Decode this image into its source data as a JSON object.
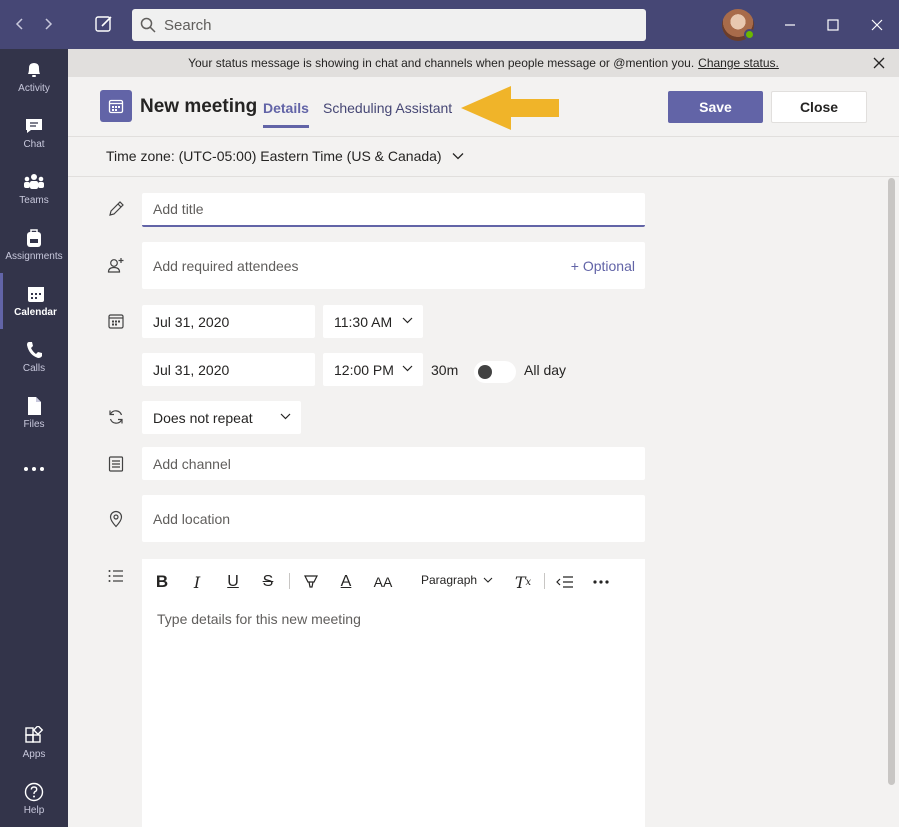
{
  "search": {
    "placeholder": "Search"
  },
  "rail": {
    "items": [
      {
        "label": "Activity"
      },
      {
        "label": "Chat"
      },
      {
        "label": "Teams"
      },
      {
        "label": "Assignments"
      },
      {
        "label": "Calendar"
      },
      {
        "label": "Calls"
      },
      {
        "label": "Files"
      },
      {
        "label": "Apps"
      },
      {
        "label": "Help"
      }
    ]
  },
  "banner": {
    "text": "Your status message is showing in chat and channels when people message or @mention you.",
    "link": "Change status."
  },
  "header": {
    "title": "New meeting",
    "tabs": [
      "Details",
      "Scheduling Assistant"
    ],
    "save_label": "Save",
    "close_label": "Close"
  },
  "timezone": "Time zone: (UTC-05:00) Eastern Time (US & Canada)",
  "form": {
    "title_placeholder": "Add title",
    "attendees_placeholder": "Add required attendees",
    "optional_label": "+ Optional",
    "start_date": "Jul 31, 2020",
    "start_time": "11:30 AM",
    "end_date": "Jul 31, 2020",
    "end_time": "12:00 PM",
    "duration": "30m",
    "all_day_label": "All day",
    "all_day_on": false,
    "repeat": "Does not repeat",
    "channel_placeholder": "Add channel",
    "location_placeholder": "Add location",
    "editor": {
      "paragraph_label": "Paragraph",
      "placeholder": "Type details for this new meeting"
    }
  },
  "colors": {
    "titlebar": "#464775",
    "rail": "#33344a",
    "accent": "#6264a7",
    "arrow": "#f0b429",
    "presence": "#6bb700"
  }
}
